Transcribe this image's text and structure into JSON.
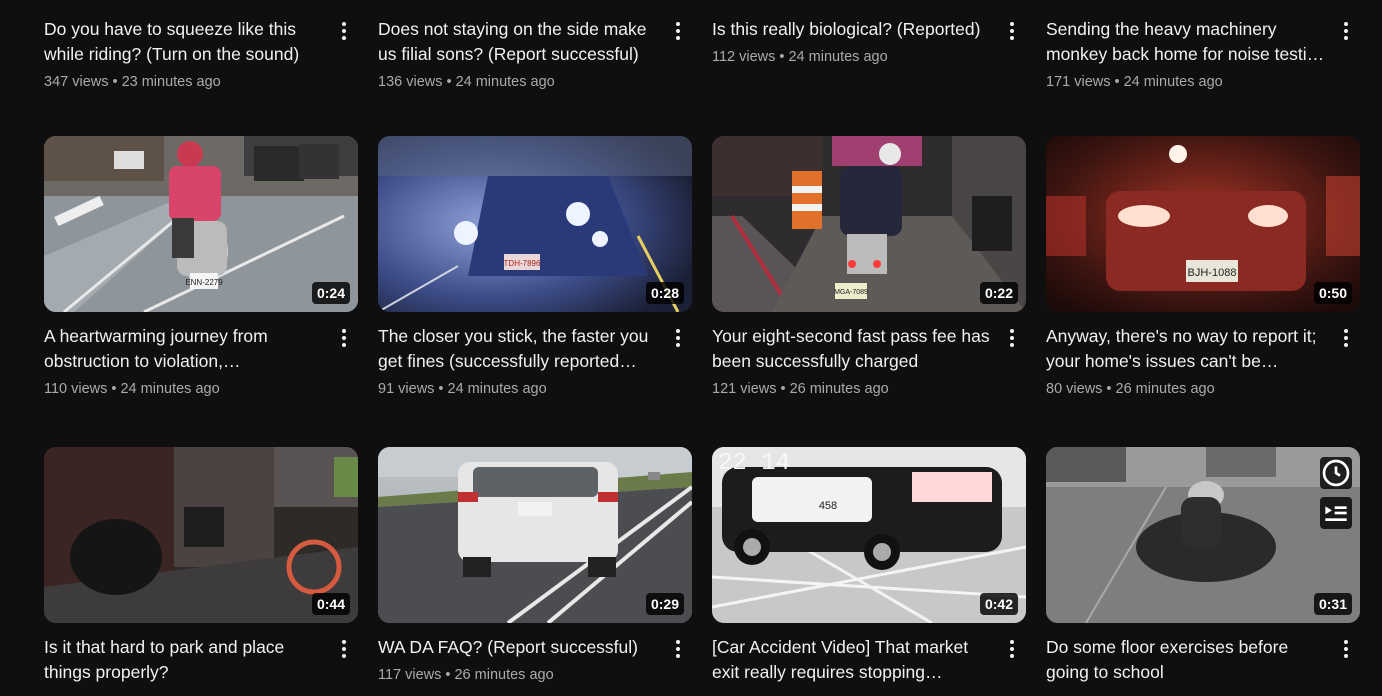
{
  "videos": [
    {
      "title": "Do you have to squeeze like this while riding? (Turn on the sound)",
      "views": "347 views",
      "age": "23 minutes ago"
    },
    {
      "title": "Does not staying on the side make us filial sons? (Report successful)",
      "views": "136 views",
      "age": "24 minutes ago"
    },
    {
      "title": "Is this really biological? (Reported)",
      "views": "112 views",
      "age": "24 minutes ago"
    },
    {
      "title": "Sending the heavy machinery monkey back home for noise testi…",
      "views": "171 views",
      "age": "24 minutes ago"
    },
    {
      "title": "A heartwarming journey from obstruction to violation, culminatin…",
      "views": "110 views",
      "age": "24 minutes ago",
      "duration": "0:24",
      "plate": "ENN-2279"
    },
    {
      "title": "The closer you stick, the faster you get fines (successfully reported tw…",
      "views": "91 views",
      "age": "24 minutes ago",
      "duration": "0:28",
      "plate": "TDH-7896"
    },
    {
      "title": "Your eight-second fast pass fee has been successfully charged",
      "views": "121 views",
      "age": "26 minutes ago",
      "duration": "0:22",
      "plate": "MGA-7089"
    },
    {
      "title": "Anyway, there's no way to report it; your home's issues can't be…",
      "views": "80 views",
      "age": "26 minutes ago",
      "duration": "0:50",
      "plate": "BJH-1088"
    },
    {
      "title": "Is it that hard to park and place things properly?",
      "views": "",
      "age": "",
      "duration": "0:44"
    },
    {
      "title": "WA DA FAQ? (Report successful)",
      "views": "117 views",
      "age": "26 minutes ago",
      "duration": "0:29"
    },
    {
      "title": "[Car Accident Video] That market exit really requires stopping before…",
      "views": "",
      "age": "",
      "duration": "0:42",
      "overlay_time": "22 14",
      "car_number": "458"
    },
    {
      "title": "Do some floor exercises before going to school",
      "views": "",
      "age": "",
      "duration": "0:31"
    }
  ],
  "icons": {
    "more": "more-vert-icon",
    "watch_later": "clock-icon",
    "add_to_queue": "queue-icon"
  },
  "separator": "•"
}
